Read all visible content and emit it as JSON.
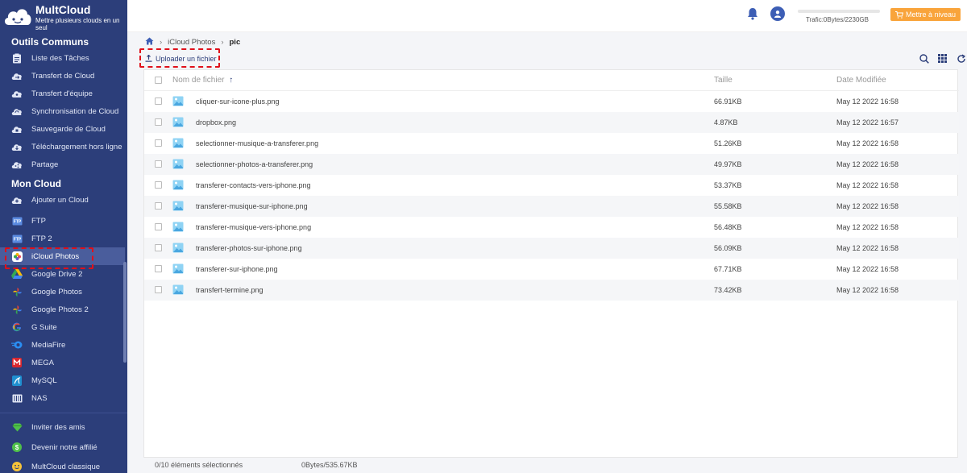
{
  "app": {
    "title": "MultCloud",
    "subtitle": "Mettre plusieurs clouds en un seul"
  },
  "sidebar": {
    "section_tools": "Outils Communs",
    "tools": [
      {
        "label": "Liste des Tâches",
        "icon": "task-list-icon"
      },
      {
        "label": "Transfert de Cloud",
        "icon": "cloud-transfer-icon"
      },
      {
        "label": "Transfert d'équipe",
        "icon": "team-transfer-icon"
      },
      {
        "label": "Synchronisation de Cloud",
        "icon": "cloud-sync-icon"
      },
      {
        "label": "Sauvegarde de Cloud",
        "icon": "cloud-backup-icon"
      },
      {
        "label": "Téléchargement hors ligne",
        "icon": "offline-download-icon"
      },
      {
        "label": "Partage",
        "icon": "share-icon"
      }
    ],
    "section_clouds": "Mon Cloud",
    "add_cloud": "Ajouter un Cloud",
    "clouds": [
      {
        "label": "FTP",
        "icon": "ftp-icon"
      },
      {
        "label": "FTP 2",
        "icon": "ftp-icon"
      },
      {
        "label": "iCloud Photos",
        "icon": "icloud-photos-icon",
        "active": true
      },
      {
        "label": "Google Drive 2",
        "icon": "google-drive-icon"
      },
      {
        "label": "Google Photos",
        "icon": "google-photos-icon"
      },
      {
        "label": "Google Photos 2",
        "icon": "google-photos-icon"
      },
      {
        "label": "G Suite",
        "icon": "g-suite-icon"
      },
      {
        "label": "MediaFire",
        "icon": "mediafire-icon"
      },
      {
        "label": "MEGA",
        "icon": "mega-icon"
      },
      {
        "label": "MySQL",
        "icon": "mysql-icon"
      },
      {
        "label": "NAS",
        "icon": "nas-icon"
      }
    ],
    "bottom": [
      {
        "label": "Inviter des amis",
        "icon": "gem-icon"
      },
      {
        "label": "Devenir notre affilié",
        "icon": "dollar-icon"
      },
      {
        "label": "MultCloud classique",
        "icon": "smile-icon"
      }
    ]
  },
  "topbar": {
    "traffic": "Trafic:0Bytes/2230GB",
    "traffic_used_fraction": 0,
    "upgrade_label": "Mettre à niveau"
  },
  "breadcrumb": {
    "items": [
      "iCloud Photos",
      "pic"
    ]
  },
  "toolbar": {
    "upload_label": "Uploader un fichier"
  },
  "table": {
    "columns": {
      "name": "Nom de fichier",
      "sort_indicator": "↑",
      "size": "Taille",
      "date": "Date Modifiée"
    },
    "rows": [
      {
        "name": "cliquer-sur-icone-plus.png",
        "size": "66.91KB",
        "date": "May 12 2022 16:58"
      },
      {
        "name": "dropbox.png",
        "size": "4.87KB",
        "date": "May 12 2022 16:57"
      },
      {
        "name": "selectionner-musique-a-transferer.png",
        "size": "51.26KB",
        "date": "May 12 2022 16:58"
      },
      {
        "name": "selectionner-photos-a-transferer.png",
        "size": "49.97KB",
        "date": "May 12 2022 16:58"
      },
      {
        "name": "transferer-contacts-vers-iphone.png",
        "size": "53.37KB",
        "date": "May 12 2022 16:58"
      },
      {
        "name": "transferer-musique-sur-iphone.png",
        "size": "55.58KB",
        "date": "May 12 2022 16:58"
      },
      {
        "name": "transferer-musique-vers-iphone.png",
        "size": "56.48KB",
        "date": "May 12 2022 16:58"
      },
      {
        "name": "transferer-photos-sur-iphone.png",
        "size": "56.09KB",
        "date": "May 12 2022 16:58"
      },
      {
        "name": "transferer-sur-iphone.png",
        "size": "67.71KB",
        "date": "May 12 2022 16:58"
      },
      {
        "name": "transfert-termine.png",
        "size": "73.42KB",
        "date": "May 12 2022 16:58"
      }
    ]
  },
  "footer": {
    "selected": "0/10 éléments sélectionnés",
    "size": "0Bytes/535.67KB"
  },
  "colors": {
    "sidebar_bg": "#2c3e7a",
    "accent": "#f9a43b",
    "highlight": "#e0101a"
  }
}
